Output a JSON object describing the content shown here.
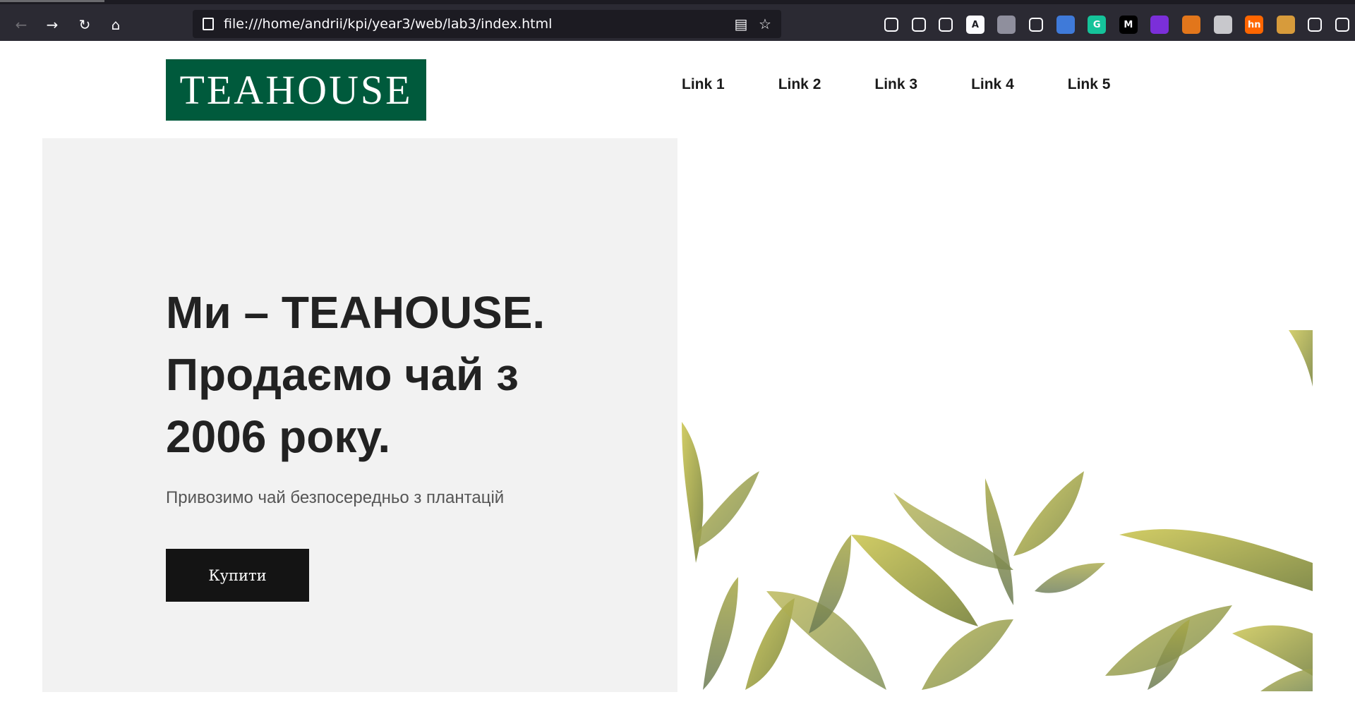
{
  "browser": {
    "url": "file:///home/andrii/kpi/year3/web/lab3/index.html",
    "nav_icons": [
      "back-icon",
      "forward-icon",
      "reload-icon",
      "home-icon"
    ],
    "extensions": [
      {
        "name": "pocket-icon",
        "label": "",
        "color": "#2b2a33"
      },
      {
        "name": "library-icon",
        "label": "",
        "color": "#2b2a33"
      },
      {
        "name": "sidebar-icon",
        "label": "",
        "color": "#2b2a33"
      },
      {
        "name": "account-icon",
        "label": "A",
        "color": "#fbfbfe"
      },
      {
        "name": "globe-icon",
        "label": "",
        "color": "#8f8f9d"
      },
      {
        "name": "lock-ext-icon",
        "label": "",
        "color": "#2b2a33"
      },
      {
        "name": "save-icon",
        "label": "",
        "color": "#3f7ad9"
      },
      {
        "name": "grammarly-icon",
        "label": "G",
        "color": "#15c39a"
      },
      {
        "name": "medium-icon",
        "label": "M",
        "color": "#000000"
      },
      {
        "name": "ghost-icon",
        "label": "",
        "color": "#7b2fd9"
      },
      {
        "name": "metamask-icon",
        "label": "",
        "color": "#e2761b"
      },
      {
        "name": "notes-icon",
        "label": "",
        "color": "#c8c8cc"
      },
      {
        "name": "hackernews-icon",
        "label": "hn",
        "color": "#ff6600"
      },
      {
        "name": "cookie-icon",
        "label": "",
        "color": "#d79b3b"
      },
      {
        "name": "extensions-icon",
        "label": "",
        "color": "#2b2a33"
      },
      {
        "name": "menu-icon",
        "label": "",
        "color": "#2b2a33"
      }
    ]
  },
  "header": {
    "logo_text": "TEAHOUSE",
    "logo_color": "#005a3c",
    "nav": [
      "Link 1",
      "Link 2",
      "Link 3",
      "Link 4",
      "Link 5"
    ]
  },
  "hero": {
    "headline_lines": [
      "Ми – TEAHOUSE.",
      "Продаємо чай з",
      "2006 року."
    ],
    "subtitle": "Привозимо чай безпосередньо з плантацій",
    "button_label": "Купити",
    "image_description": "watercolor-tea-leaves"
  }
}
